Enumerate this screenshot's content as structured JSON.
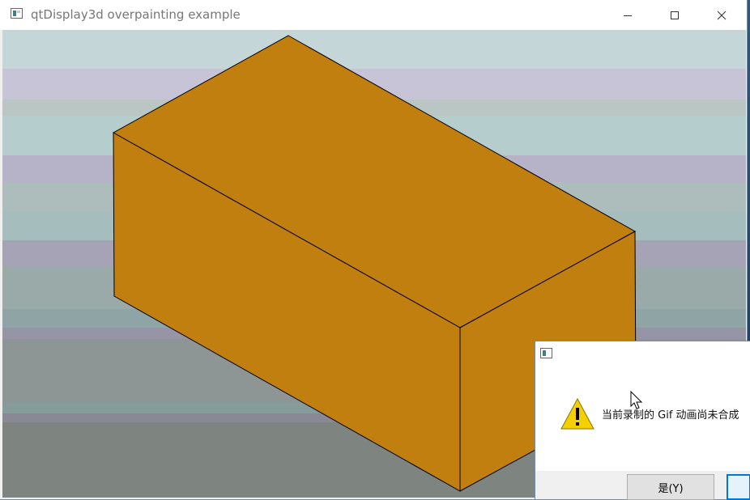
{
  "window": {
    "title": "qtDisplay3d overpainting example",
    "icon": "app-window-icon",
    "controls": {
      "minimize_icon": "minimize-icon",
      "maximize_icon": "maximize-icon",
      "close_icon": "close-icon"
    }
  },
  "scene": {
    "object": "box",
    "face_color": "#c07f0e",
    "edge_color": "#000000"
  },
  "dialog": {
    "title": "",
    "icon": "warning-icon",
    "message": "当前录制的 Gif 动画尚未合成",
    "buttons": {
      "yes_label": "是(Y)",
      "no_label": ""
    }
  },
  "colors": {
    "titlebar_text": "#777777",
    "warning_yellow": "#f5d000",
    "focus_blue": "#0078d7"
  }
}
